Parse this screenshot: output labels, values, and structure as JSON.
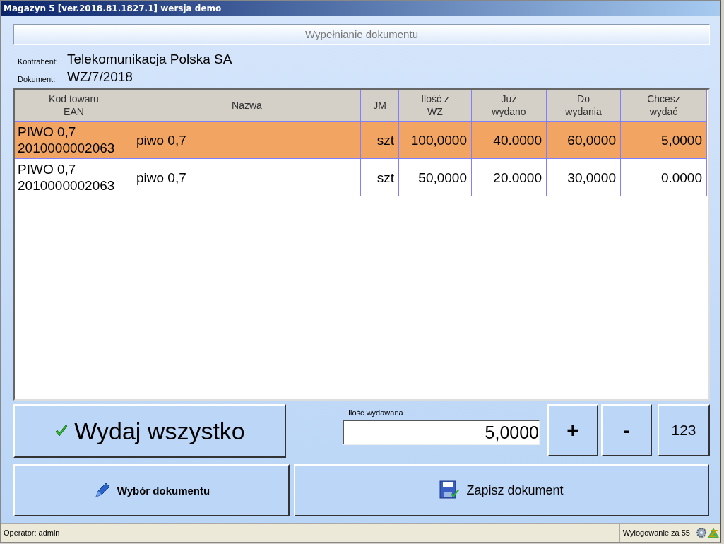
{
  "window": {
    "title": "Magazyn 5 [ver.2018.81.1827.1]  wersja demo"
  },
  "header": {
    "title": "Wypełnianie dokumentu"
  },
  "info": [
    {
      "label": "Kontrahent:",
      "value": "Telekomunikacja Polska SA"
    },
    {
      "label": "Dokument:",
      "value": "WZ/7/2018"
    }
  ],
  "table": {
    "columns": [
      "Kod towaru\nEAN",
      "Nazwa",
      "JM",
      "Ilość z\nWZ",
      "Już\nwydano",
      "Do\nwydania",
      "Chcesz\nwydać"
    ],
    "rows": [
      {
        "selected": true,
        "cells": [
          "PIWO 0,7\n2010000002063",
          "piwo 0,7",
          "szt",
          "100,0000",
          "40.0000",
          "60,0000",
          "5,0000"
        ]
      },
      {
        "selected": false,
        "cells": [
          "PIWO 0,7\n2010000002063",
          "piwo 0,7",
          "szt",
          "50,0000",
          "20.0000",
          "30,0000",
          "0.0000"
        ]
      }
    ]
  },
  "issue_all_button": "Wydaj wszystko",
  "quantity": {
    "label": "Ilość wydawana",
    "value": "5,0000"
  },
  "keypad": [
    "+",
    "-",
    "123"
  ],
  "choose_document_button": "Wybór dokumentu",
  "save_document_button": "Zapisz dokument",
  "status_bar": {
    "operator": "Operator: admin",
    "logout": "Wylogowanie za 55"
  }
}
